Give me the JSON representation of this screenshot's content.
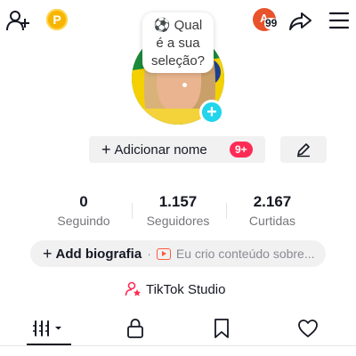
{
  "top_bar": {
    "notification": {
      "initial": "A",
      "count": "99"
    }
  },
  "coin": {
    "label": "P"
  },
  "avatar": {
    "question_bubble": "⚽ Qual\né a sua\nseleção?"
  },
  "name_button": {
    "plus": "+",
    "label": "Adicionar nome",
    "badge": "9+"
  },
  "stats": [
    {
      "value": "0",
      "label": "Seguindo"
    },
    {
      "value": "1.157",
      "label": "Seguidores"
    },
    {
      "value": "2.167",
      "label": "Curtidas"
    }
  ],
  "bio": {
    "plus": "+",
    "add_label": "Add biografia",
    "separator": "·",
    "hint": "Eu crio conteúdo sobre..."
  },
  "studio": {
    "label": "TikTok Studio"
  },
  "tabs": [
    {
      "name": "videos",
      "icon": "grid-icon"
    },
    {
      "name": "private",
      "icon": "lock-icon"
    },
    {
      "name": "favorites",
      "icon": "bookmark-icon"
    },
    {
      "name": "liked",
      "icon": "heart-icon"
    }
  ],
  "colors": {
    "accent_pink": "#fe2c55",
    "cyan": "#20d5ec",
    "coin_yellow": "#f7b500",
    "notif_orange": "#e8532b"
  }
}
